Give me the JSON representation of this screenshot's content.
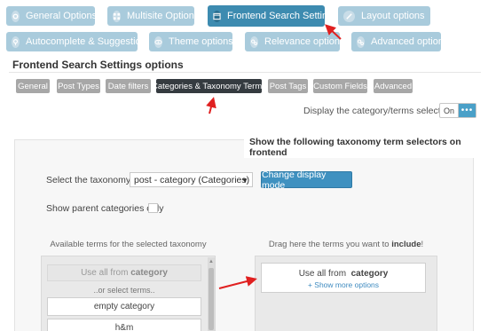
{
  "main_tabs": [
    {
      "label": "General Options",
      "icon": "gear-icon",
      "active": false
    },
    {
      "label": "Multisite Options",
      "icon": "grid-icon",
      "active": false
    },
    {
      "label": "Frontend Search Settings",
      "icon": "window-icon",
      "active": true
    },
    {
      "label": "Layout options",
      "icon": "pencil-icon",
      "active": false
    },
    {
      "label": "Autocomplete & Suggestions",
      "icon": "pin-icon",
      "active": false
    },
    {
      "label": "Theme options",
      "icon": "eye-icon",
      "active": false
    },
    {
      "label": "Relevance options",
      "icon": "gears-icon",
      "active": false
    },
    {
      "label": "Advanced options",
      "icon": "gears-icon",
      "active": false
    }
  ],
  "section_title": "Frontend Search Settings options",
  "sub_tabs": [
    {
      "label": "General",
      "active": false
    },
    {
      "label": "Post Types",
      "active": false
    },
    {
      "label": "Date filters",
      "active": false
    },
    {
      "label": "Categories & Taxonomy Terms",
      "active": true
    },
    {
      "label": "Post Tags",
      "active": false
    },
    {
      "label": "Custom Fields",
      "active": false
    },
    {
      "label": "Advanced",
      "active": false
    }
  ],
  "display_selector": {
    "label": "Display the category/terms selectors?",
    "toggle": "On",
    "toggle_more": "•••"
  },
  "panel": {
    "title": "Show the following taxonomy term selectors on frontend",
    "taxonomy_label": "Select the taxonomy:",
    "taxonomy_value": "post - category (Categories)",
    "change_mode_button": "Change display mode",
    "parent_label": "Show parent categories only",
    "available_heading": "Available terms for the selected taxonomy",
    "drag_heading_prefix": "Drag here the terms you want to ",
    "drag_heading_bold": "include",
    "drag_heading_suffix": "!",
    "use_all_prefix": "Use all from ",
    "use_all_bold": "category",
    "or_select": "..or select terms..",
    "terms": [
      "empty category",
      "h&m"
    ],
    "show_more": "+ Show more options"
  },
  "colors": {
    "accent": "#3f91c0",
    "tab_inactive": "#a9cbdc",
    "tab_active": "#3d8bb0",
    "subtab_active": "#353b40",
    "annotation": "#e02020"
  }
}
